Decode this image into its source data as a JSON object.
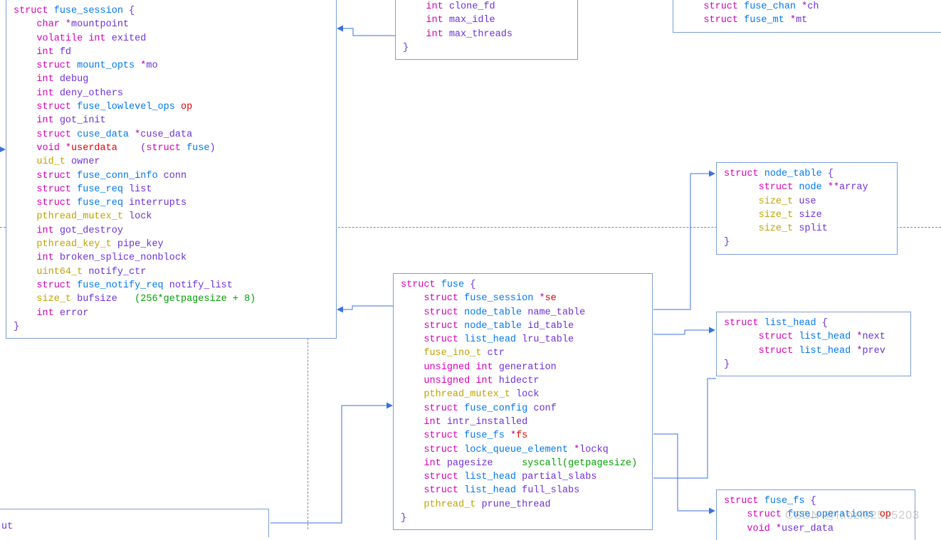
{
  "colors": {
    "border": "#7b9ed6",
    "arrow": "#3a72e0",
    "keyword": "#d600b8",
    "type": "#0078f0",
    "var": "#6e31d8",
    "alt": "#bfa300",
    "green": "#00a000",
    "red": "#e50000"
  },
  "watermark": "CSDN @laozi82525203",
  "frag_but": "ut",
  "boxes": {
    "fuse_session": {
      "decl": {
        "kw": "struct",
        "type": "fuse_session",
        "open": "{"
      },
      "lines": [
        {
          "t": [
            "kw:char",
            " ",
            "sym:*",
            "var:mountpoint"
          ]
        },
        {
          "t": [
            "kw:volatile int",
            " ",
            "var:exited"
          ]
        },
        {
          "t": [
            "kw:int",
            " ",
            "var:fd"
          ]
        },
        {
          "t": [
            "kw:struct",
            " ",
            "typ:mount_opts",
            " ",
            "sym:*",
            "var:mo"
          ]
        },
        {
          "t": [
            "kw:int",
            " ",
            "var:debug"
          ]
        },
        {
          "t": [
            "kw:int",
            " ",
            "var:deny_others"
          ]
        },
        {
          "t": [
            "kw:struct",
            " ",
            "typ:fuse_lowlevel_ops",
            " ",
            "red:op"
          ]
        },
        {
          "t": [
            "kw:int",
            " ",
            "var:got_init"
          ]
        },
        {
          "t": [
            "kw:struct",
            " ",
            "typ:cuse_data",
            " ",
            "sym:*",
            "var:cuse_data"
          ]
        },
        {
          "t": [
            "kw:void",
            " ",
            "sym:*",
            "red:userdata",
            "plain:    ",
            "paren:(",
            "kw:struct",
            " ",
            "typ:fuse",
            "paren:)"
          ]
        },
        {
          "t": [
            "alt:uid_t",
            " ",
            "var:owner"
          ]
        },
        {
          "t": [
            "kw:struct",
            " ",
            "typ:fuse_conn_info",
            " ",
            "var:conn"
          ]
        },
        {
          "t": [
            "kw:struct",
            " ",
            "typ:fuse_req",
            " ",
            "var:list"
          ]
        },
        {
          "t": [
            "kw:struct",
            " ",
            "typ:fuse_req",
            " ",
            "var:interrupts"
          ]
        },
        {
          "t": [
            "alt:pthread_mutex_t",
            " ",
            "var:lock"
          ]
        },
        {
          "t": [
            "kw:int",
            " ",
            "var:got_destroy"
          ]
        },
        {
          "t": [
            "alt:pthread_key_t",
            " ",
            "var:pipe_key"
          ]
        },
        {
          "t": [
            "kw:int",
            " ",
            "var:broken_splice_nonblock"
          ]
        },
        {
          "t": [
            "alt:uint64_t",
            " ",
            "var:notify_ctr"
          ]
        },
        {
          "t": [
            "kw:struct",
            " ",
            "typ:fuse_notify_req",
            " ",
            "var:notify_list"
          ]
        },
        {
          "t": [
            "alt:size_t",
            " ",
            "var:bufsize",
            "plain:   ",
            "green:(256*getpagesize + 8)"
          ]
        },
        {
          "t": [
            "kw:int",
            " ",
            "var:error"
          ]
        }
      ],
      "close": "}"
    },
    "fuse_mt_top": {
      "lines": [
        {
          "t": [
            "kw:int",
            " ",
            "var:clone_fd"
          ]
        },
        {
          "t": [
            "kw:int",
            " ",
            "var:max_idle"
          ]
        },
        {
          "t": [
            "kw:int",
            " ",
            "var:max_threads"
          ]
        }
      ],
      "close": "}"
    },
    "fuse_chan_top": {
      "lines": [
        {
          "t": [
            "kw:struct",
            " ",
            "typ:fuse_chan",
            " ",
            "sym:*",
            "var:ch"
          ]
        },
        {
          "t": [
            "kw:struct",
            " ",
            "typ:fuse_mt",
            " ",
            "sym:*",
            "var:mt"
          ]
        }
      ]
    },
    "node_table": {
      "decl": {
        "kw": "struct",
        "type": "node_table",
        "open": "{"
      },
      "lines": [
        {
          "t": [
            "kw:struct",
            " ",
            "typ:node",
            " ",
            "sym:**",
            "var:array"
          ]
        },
        {
          "t": [
            "alt:size_t",
            " ",
            "var:use"
          ]
        },
        {
          "t": [
            "alt:size_t",
            " ",
            "var:size"
          ]
        },
        {
          "t": [
            "alt:size_t",
            " ",
            "var:split"
          ]
        }
      ],
      "close": "}"
    },
    "fuse": {
      "decl": {
        "kw": "struct",
        "type": "fuse",
        "open": "{"
      },
      "lines": [
        {
          "t": [
            "kw:struct",
            " ",
            "typ:fuse_session",
            " ",
            "sym:*",
            "red:se"
          ]
        },
        {
          "t": [
            "kw:struct",
            " ",
            "typ:node_table",
            " ",
            "var:name_table"
          ]
        },
        {
          "t": [
            "kw:struct",
            " ",
            "typ:node_table",
            " ",
            "var:id_table"
          ]
        },
        {
          "t": [
            "kw:struct",
            " ",
            "typ:list_head",
            " ",
            "var:lru_table"
          ]
        },
        {
          "t": [
            "alt:fuse_ino_t",
            " ",
            "var:ctr"
          ]
        },
        {
          "t": [
            "kw:unsigned int",
            " ",
            "var:generation"
          ]
        },
        {
          "t": [
            "kw:unsigned int",
            " ",
            "var:hidectr"
          ]
        },
        {
          "t": [
            "alt:pthread_mutex_t",
            " ",
            "var:lock"
          ]
        },
        {
          "t": [
            "kw:struct",
            " ",
            "typ:fuse_config",
            " ",
            "var:conf"
          ]
        },
        {
          "t": [
            "kw:int",
            " ",
            "var:intr_installed"
          ]
        },
        {
          "t": [
            "kw:struct",
            " ",
            "typ:fuse_fs",
            " ",
            "sym:*",
            "red:fs"
          ]
        },
        {
          "t": [
            "kw:struct",
            " ",
            "typ:lock_queue_element",
            " ",
            "sym:*",
            "var:lockq"
          ]
        },
        {
          "t": [
            "kw:int",
            " ",
            "var:pagesize",
            "plain:     ",
            "green:syscall(getpagesize)"
          ]
        },
        {
          "t": [
            "kw:struct",
            " ",
            "typ:list_head",
            " ",
            "var:partial_slabs"
          ]
        },
        {
          "t": [
            "kw:struct",
            " ",
            "typ:list_head",
            " ",
            "var:full_slabs"
          ]
        },
        {
          "t": [
            "alt:pthread_t",
            " ",
            "var:prune_thread"
          ]
        }
      ],
      "close": "}"
    },
    "list_head": {
      "decl": {
        "kw": "struct",
        "type": "list_head",
        "open": "{"
      },
      "lines": [
        {
          "t": [
            "kw:struct",
            " ",
            "typ:list_head",
            " ",
            "sym:*",
            "var:next"
          ]
        },
        {
          "t": [
            "kw:struct",
            " ",
            "typ:list_head",
            " ",
            "sym:*",
            "var:prev"
          ]
        }
      ],
      "close": "}"
    },
    "fuse_fs": {
      "decl": {
        "kw": "struct",
        "type": "fuse_fs",
        "open": "{"
      },
      "lines": [
        {
          "t": [
            "kw:struct",
            " ",
            "typ:fuse_operations",
            " ",
            "red:op"
          ]
        },
        {
          "t": [
            "kw:void",
            " ",
            "sym:*",
            "var:user_data"
          ]
        }
      ]
    }
  }
}
